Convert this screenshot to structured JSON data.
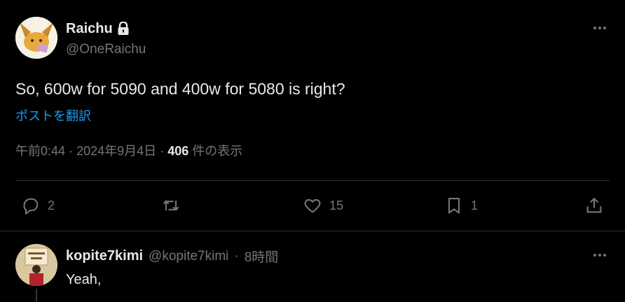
{
  "tweet": {
    "display_name": "Raichu",
    "handle": "@OneRaichu",
    "text": "So, 600w for 5090 and 400w for 5080 is right?",
    "translate_label": "ポストを翻訳",
    "time": "午前0:44",
    "dot1": "·",
    "date": "2024年9月4日",
    "dot2": "·",
    "views_count": "406",
    "views_label": " 件の表示",
    "actions": {
      "reply_count": "2",
      "retweet_count": "",
      "like_count": "15",
      "bookmark_count": "1"
    }
  },
  "reply": {
    "display_name": "kopite7kimi",
    "handle": "@kopite7kimi",
    "sep": "·",
    "time": "8時間",
    "text": "Yeah,"
  },
  "icons": {
    "lock": "lock-icon",
    "more": "more-horizontal-icon",
    "reply": "reply-bubble-icon",
    "retweet": "retweet-icon",
    "like": "heart-icon",
    "bookmark": "bookmark-icon",
    "share": "share-icon"
  },
  "colors": {
    "background": "#000000",
    "text": "#e7e9ea",
    "muted": "#71767b",
    "link": "#1d9bf0",
    "divider": "#2f3336"
  }
}
